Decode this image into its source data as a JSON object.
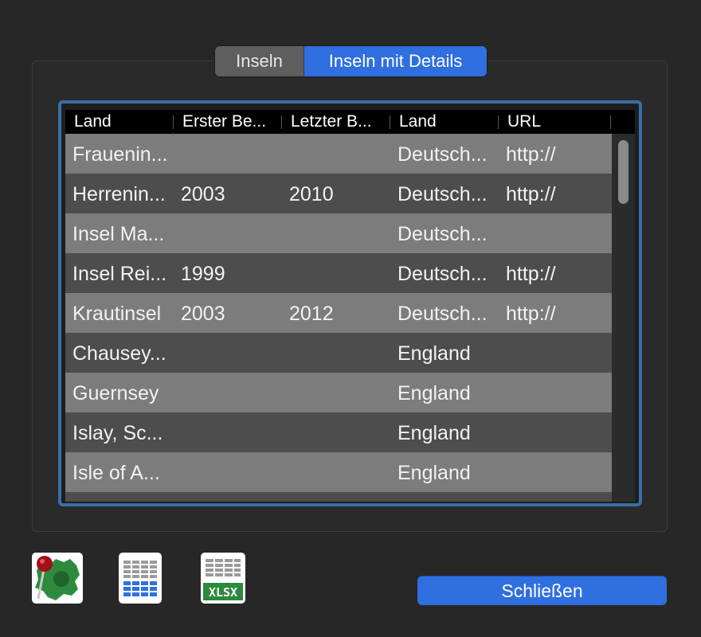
{
  "tabs": [
    {
      "label": "Inseln",
      "selected": false
    },
    {
      "label": "Inseln mit Details",
      "selected": true
    }
  ],
  "table": {
    "columns": [
      "Land",
      "Erster Be...",
      "Letzter B...",
      "Land",
      "URL"
    ],
    "rows": [
      [
        "Frauenin...",
        "",
        "",
        "Deutsch...",
        "http://"
      ],
      [
        "Herrenin...",
        "2003",
        "2010",
        "Deutsch...",
        "http://"
      ],
      [
        "Insel Ma...",
        "",
        "",
        "Deutsch...",
        ""
      ],
      [
        "Insel Rei...",
        "1999",
        "",
        "Deutsch...",
        "http://"
      ],
      [
        "Krautinsel",
        "2003",
        "2012",
        "Deutsch...",
        "http://"
      ],
      [
        "Chausey...",
        "",
        "",
        "England",
        ""
      ],
      [
        "Guernsey",
        "",
        "",
        "England",
        ""
      ],
      [
        "Islay, Sc...",
        "",
        "",
        "England",
        ""
      ],
      [
        "Isle of A...",
        "",
        "",
        "England",
        ""
      ],
      [
        "",
        "",
        "",
        "",
        ""
      ]
    ]
  },
  "buttons": {
    "map_icon": "map-pin-icon",
    "table_icon": "table-grid-icon",
    "xlsx_label": "XLSX",
    "close_label": "Schließen"
  },
  "colors": {
    "accent": "#2f6fe0",
    "focus_ring": "#3b6ea8"
  }
}
